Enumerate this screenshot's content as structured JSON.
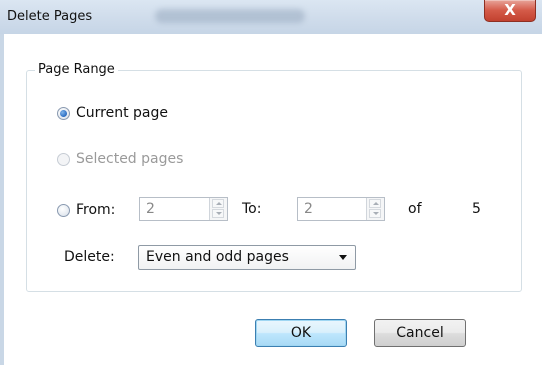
{
  "dialog": {
    "title": "Delete Pages",
    "close_glyph": "X"
  },
  "page_range": {
    "group_label": "Page Range",
    "current_page_label": "Current page",
    "selected_pages_label": "Selected pages",
    "from_label": "From:",
    "from_value": "2",
    "to_label": "To:",
    "to_value": "2",
    "of_label": "of",
    "total_pages": "5",
    "selected_option": "current_page"
  },
  "delete": {
    "label": "Delete:",
    "selected": "Even and odd pages"
  },
  "buttons": {
    "ok": "OK",
    "cancel": "Cancel"
  },
  "colors": {
    "accent": "#3c7fb1",
    "close_button": "#c2412f",
    "disabled_text": "#9a9a9a"
  }
}
